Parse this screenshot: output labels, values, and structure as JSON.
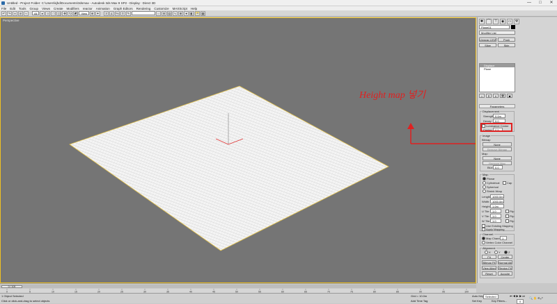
{
  "window": {
    "title": "Untitled    -  Project Folder: C:\\Users\\kjhd\\Documents\\3dsmax    -  Autodesk 3ds Max 9 SP2    -  Display : Direct 3D",
    "controls": [
      "—",
      "□",
      "✕"
    ]
  },
  "menu": [
    "File",
    "Edit",
    "Tools",
    "Group",
    "Views",
    "Create",
    "Modifiers",
    "reactor",
    "Animation",
    "Graph Editors",
    "Rendering",
    "Customize",
    "MAXScript",
    "Help"
  ],
  "toolbar": {
    "selection_filter": "All",
    "coord_system": "View",
    "named_selection": ""
  },
  "viewport": {
    "label": "Perspective",
    "annotation": "Height map 넣기",
    "annotation_color": "#e02020",
    "plane_color": "#ffffff",
    "background": "#757575",
    "border_color": "#f0c020"
  },
  "command_panel": {
    "tabs": [
      "create-icon",
      "modify-icon",
      "hierarchy-icon",
      "motion-icon",
      "display-icon",
      "utilities-icon"
    ],
    "object_name": "Plane01",
    "object_color": "#000000",
    "modifier_list": "Modifier List",
    "buttons": {
      "uvw": "Unwrap UVW",
      "push": "Push",
      "slice": "Slice",
      "skin": "Skin"
    },
    "stack": [
      {
        "label": "Displace",
        "selected": true
      },
      {
        "label": "Plane",
        "selected": false
      }
    ],
    "parameters": {
      "header": "Parameters",
      "displacement_group": "Displacement",
      "strength_label": "Strength:",
      "strength": "0.0m",
      "decay_label": "Decay:",
      "decay": "0.0",
      "luminance_center": "Luminance Center",
      "center_label": "Center:",
      "center": "0.5",
      "image_group": "Image",
      "bitmap_label": "Bitmap",
      "bitmap_button": "None",
      "remove_bitmap": "Remove Bitmap",
      "blur_label": "Blur:",
      "blur": "0.0",
      "map_label": "Map:",
      "map_button": "None",
      "remove_map": "Remove Map",
      "map_group": "Map:",
      "mapping_options": [
        {
          "label": "Planar",
          "on": true
        },
        {
          "label": "Cylindrical",
          "on": false
        },
        {
          "label": "Spherical",
          "on": false
        },
        {
          "label": "Shrink Wrap",
          "on": false
        }
      ],
      "cap": "Cap",
      "length_label": "Length:",
      "length": "1000.0m",
      "width_label": "Width:",
      "width": "1000.0m",
      "height_label": "Height:",
      "height": "1.0m",
      "utile_label": "U Tile:",
      "utile": "1.0",
      "vtile_label": "V Tile:",
      "vtile": "1.0",
      "wtile_label": "W Tile:",
      "wtile": "1.0",
      "flip": "Flip",
      "use_existing": "Use Existing Mapping",
      "apply_mapping": "Apply Mapping",
      "channel_group": "Channel:",
      "map_channel": "Map Channel:",
      "map_channel_value": "1",
      "vertex_color": "Vertex Color Channel",
      "alignment_group": "Alignment:",
      "axes": [
        "X",
        "Y",
        "Z"
      ],
      "fit": "Fit",
      "center_btn": "Center",
      "bitmap_fit": "Bitmap Fit",
      "normal_align": "Normal Align",
      "view_align": "View Align",
      "region_fit": "Region Fit",
      "reset": "Reset",
      "acquire": "Acquire"
    }
  },
  "timeline": {
    "frame": "0 / 100",
    "ticks": [
      "0",
      "5",
      "10",
      "15",
      "20",
      "25",
      "30",
      "35",
      "40",
      "45",
      "50",
      "55",
      "60",
      "65",
      "70",
      "75",
      "80",
      "85",
      "90",
      "95",
      "100"
    ]
  },
  "status": {
    "selected": "1 Object Selected",
    "prompt": "Click or click-and-drag to select objects",
    "grid": "Grid = 10.0m",
    "add_time_tag": "Add Time Tag",
    "auto_key": "Auto Key",
    "set_key": "Set Key",
    "key_mode": "Selected",
    "key_filters": "Key Filters...",
    "frame_value": "0"
  }
}
